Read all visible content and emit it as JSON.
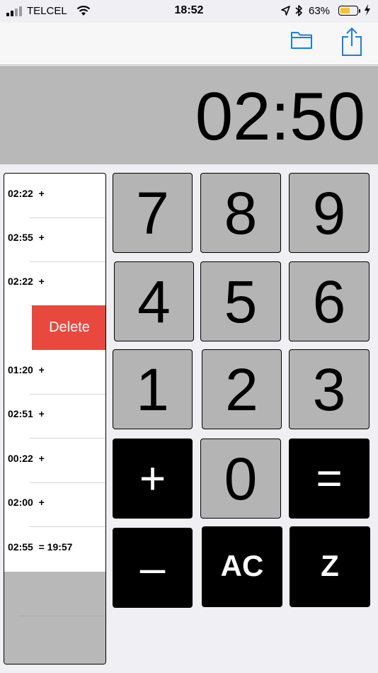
{
  "status_bar": {
    "carrier": "TELCEL",
    "time": "18:52",
    "battery_percent": "63%",
    "battery_level": 0.63,
    "icons": [
      "signal-icon",
      "wifi-icon",
      "location-icon",
      "bluetooth-icon",
      "battery-icon",
      "charging-icon"
    ]
  },
  "toolbar": {
    "icons": [
      "folder-icon",
      "share-icon"
    ],
    "accent_color": "#1a7fe0"
  },
  "display": {
    "value": "02:50"
  },
  "history": {
    "entries": [
      "02:22  +",
      "02:55  +",
      "02:22  +",
      "",
      "01:20  +",
      "02:51  +",
      "00:22  +",
      "02:00  +",
      "02:55  = 19:57"
    ],
    "delete_label": "Delete",
    "delete_color": "#e9483f"
  },
  "keypad": {
    "k7": "7",
    "k8": "8",
    "k9": "9",
    "k4": "4",
    "k5": "5",
    "k6": "6",
    "k1": "1",
    "k2": "2",
    "k3": "3",
    "plus": "+",
    "k0": "0",
    "equals": "=",
    "minus": "–",
    "ac": "AC",
    "z": "Z"
  }
}
